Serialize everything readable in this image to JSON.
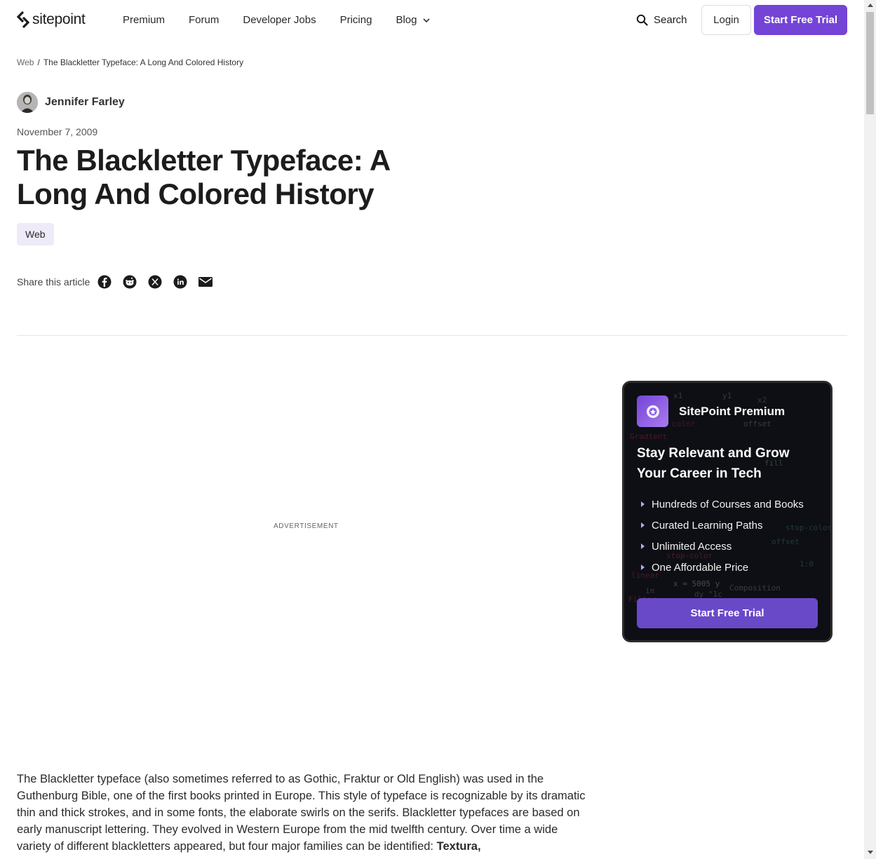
{
  "header": {
    "logo_text": "sitepoint",
    "nav": [
      {
        "label": "Premium"
      },
      {
        "label": "Forum"
      },
      {
        "label": "Developer Jobs"
      },
      {
        "label": "Pricing"
      },
      {
        "label": "Blog"
      }
    ],
    "search_label": "Search",
    "login_label": "Login",
    "trial_label": "Start Free Trial"
  },
  "breadcrumb": {
    "parent": "Web",
    "separator": "/",
    "current": "The Blackletter Typeface: A Long And Colored History"
  },
  "article": {
    "author": "Jennifer Farley",
    "date": "November 7, 2009",
    "title": "The Blackletter Typeface: A Long And Colored History",
    "tag": "Web",
    "share_label": "Share this article",
    "share_icons": [
      "facebook-icon",
      "reddit-icon",
      "x-icon",
      "linkedin-icon",
      "email-icon"
    ],
    "ad_label": "ADVERTISEMENT",
    "body_start": "The Blackletter typeface (also sometimes referred to as Gothic, Fraktur or Old English) was used in the Guthenburg Bible, one of the first books printed in Europe. This style of typeface is recognizable by its dramatic  thin and thick strokes, and in some fonts, the elaborate swirls on the serifs. Blackletter typefaces are based on early manuscript lettering. They evolved in Western Europe from the mid twelfth century. Over time a wide variety of different blackletters appeared, but four major families can be identified: ",
    "body_bold": "Textura,"
  },
  "promo": {
    "brand": "SitePoint Premium",
    "headline": "Stay Relevant and Grow Your Career in Tech",
    "features": [
      "Hundreds of Courses and Books",
      "Curated Learning Paths",
      "Unlimited Access",
      "One Affordable Price"
    ],
    "cta": "Start Free Trial"
  },
  "colors": {
    "accent": "#7444d6",
    "promo_bg": "#0d0f14",
    "tag_bg": "#eeeaf8"
  }
}
